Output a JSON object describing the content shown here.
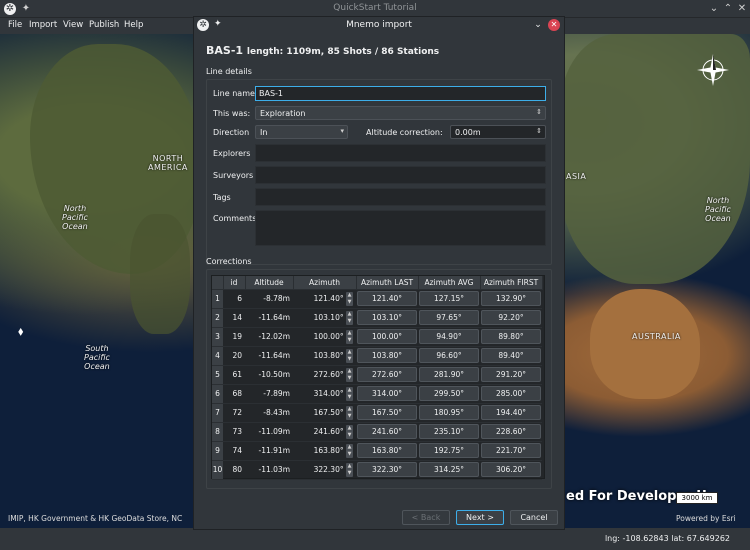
{
  "window": {
    "title": "QuickStart Tutorial"
  },
  "menu": {
    "items": [
      "File",
      "Import",
      "View",
      "Publish",
      "Help"
    ]
  },
  "map": {
    "labels": {
      "north_america": "NORTH\nAMERICA",
      "north_pacific_left": "North\nPacific\nOcean",
      "south_pacific": "South\nPacific\nOcean",
      "asia": "ASIA",
      "north_pacific_right": "North\nPacific\nOcean",
      "australia": "AUSTRALIA"
    },
    "attribution": "IMIP, HK Government & HK GeoData Store, NC",
    "dev_text": "ed For Developer U",
    "scale_label": "3000 km",
    "powered_by": "Powered by Esri"
  },
  "status": {
    "coords": "lng: -108.62843 lat: 67.649262"
  },
  "dialog": {
    "title": "Mnemo import",
    "heading": "BAS-1",
    "heading_sub": "length: 1109m, 85 Shots / 86 Stations",
    "line_details_label": "Line details",
    "labels": {
      "line_name": "Line name:",
      "this_was": "This was:",
      "direction": "Direction",
      "altitude_correction": "Altitude correction:",
      "explorers": "Explorers",
      "surveyors": "Surveyors",
      "tags": "Tags",
      "comments": "Comments"
    },
    "values": {
      "line_name": "BAS-1",
      "this_was": "Exploration",
      "direction": "In",
      "altitude_correction": "0.00m",
      "explorers": "",
      "surveyors": "",
      "tags": "",
      "comments": ""
    },
    "corrections_label": "Corrections",
    "table": {
      "columns": [
        "id",
        "Altitude",
        "Azimuth",
        "Azimuth LAST",
        "Azimuth AVG",
        "Azimuth FIRST"
      ],
      "rows": [
        {
          "n": "1",
          "id": "6",
          "altitude": "-8.78m",
          "azimuth": "121.40°",
          "last": "121.40°",
          "avg": "127.15°",
          "first": "132.90°"
        },
        {
          "n": "2",
          "id": "14",
          "altitude": "-11.64m",
          "azimuth": "103.10°",
          "last": "103.10°",
          "avg": "97.65°",
          "first": "92.20°"
        },
        {
          "n": "3",
          "id": "19",
          "altitude": "-12.02m",
          "azimuth": "100.00°",
          "last": "100.00°",
          "avg": "94.90°",
          "first": "89.80°"
        },
        {
          "n": "4",
          "id": "20",
          "altitude": "-11.64m",
          "azimuth": "103.80°",
          "last": "103.80°",
          "avg": "96.60°",
          "first": "89.40°"
        },
        {
          "n": "5",
          "id": "61",
          "altitude": "-10.50m",
          "azimuth": "272.60°",
          "last": "272.60°",
          "avg": "281.90°",
          "first": "291.20°"
        },
        {
          "n": "6",
          "id": "68",
          "altitude": "-7.89m",
          "azimuth": "314.00°",
          "last": "314.00°",
          "avg": "299.50°",
          "first": "285.00°"
        },
        {
          "n": "7",
          "id": "72",
          "altitude": "-8.43m",
          "azimuth": "167.50°",
          "last": "167.50°",
          "avg": "180.95°",
          "first": "194.40°"
        },
        {
          "n": "8",
          "id": "73",
          "altitude": "-11.09m",
          "azimuth": "241.60°",
          "last": "241.60°",
          "avg": "235.10°",
          "first": "228.60°"
        },
        {
          "n": "9",
          "id": "74",
          "altitude": "-11.91m",
          "azimuth": "163.80°",
          "last": "163.80°",
          "avg": "192.75°",
          "first": "221.70°"
        },
        {
          "n": "10",
          "id": "80",
          "altitude": "-11.03m",
          "azimuth": "322.30°",
          "last": "322.30°",
          "avg": "314.25°",
          "first": "306.20°"
        }
      ]
    },
    "buttons": {
      "back": "< Back",
      "next": "Next >",
      "cancel": "Cancel"
    }
  }
}
